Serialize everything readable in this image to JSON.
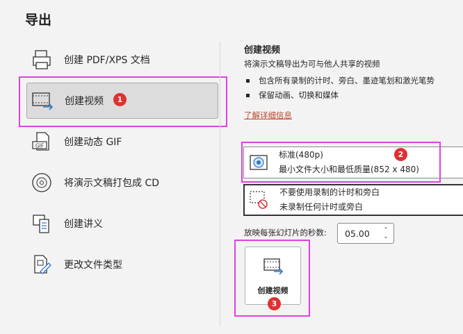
{
  "page": {
    "title": "导出"
  },
  "nav": {
    "items": [
      {
        "label": "创建 PDF/XPS 文档",
        "icon": "pdf-document-icon"
      },
      {
        "label": "创建视频",
        "icon": "video-export-icon",
        "selected": true
      },
      {
        "label": "创建动态 GIF",
        "icon": "gif-icon"
      },
      {
        "label": "将演示文稿打包成 CD",
        "icon": "cd-icon"
      },
      {
        "label": "创建讲义",
        "icon": "handout-icon"
      },
      {
        "label": "更改文件类型",
        "icon": "change-file-type-icon"
      }
    ]
  },
  "annotations": {
    "badge1": "1",
    "badge2": "2",
    "badge3": "3",
    "color": "#e040e0"
  },
  "detail": {
    "title": "创建视频",
    "description": "将演示文稿导出为可与他人共享的视频",
    "bullets": [
      "包含所有录制的计时、旁白、墨迹笔划和激光笔势",
      "保留动画、切换和媒体"
    ],
    "link": "了解详细信息"
  },
  "quality_dropdown": {
    "title": "标准(480p)",
    "subtitle": "最小文件大小和最低质量(852 x 480)",
    "icon": "quality-icon"
  },
  "timing_dropdown": {
    "title": "不要使用录制的计时和旁白",
    "subtitle": "未录制任何计时或旁白",
    "icon": "no-timing-icon"
  },
  "seconds": {
    "label": "放映每张幻灯片的秒数:",
    "value": "05.00"
  },
  "create_button": {
    "label": "创建视频",
    "icon": "create-video-icon"
  }
}
